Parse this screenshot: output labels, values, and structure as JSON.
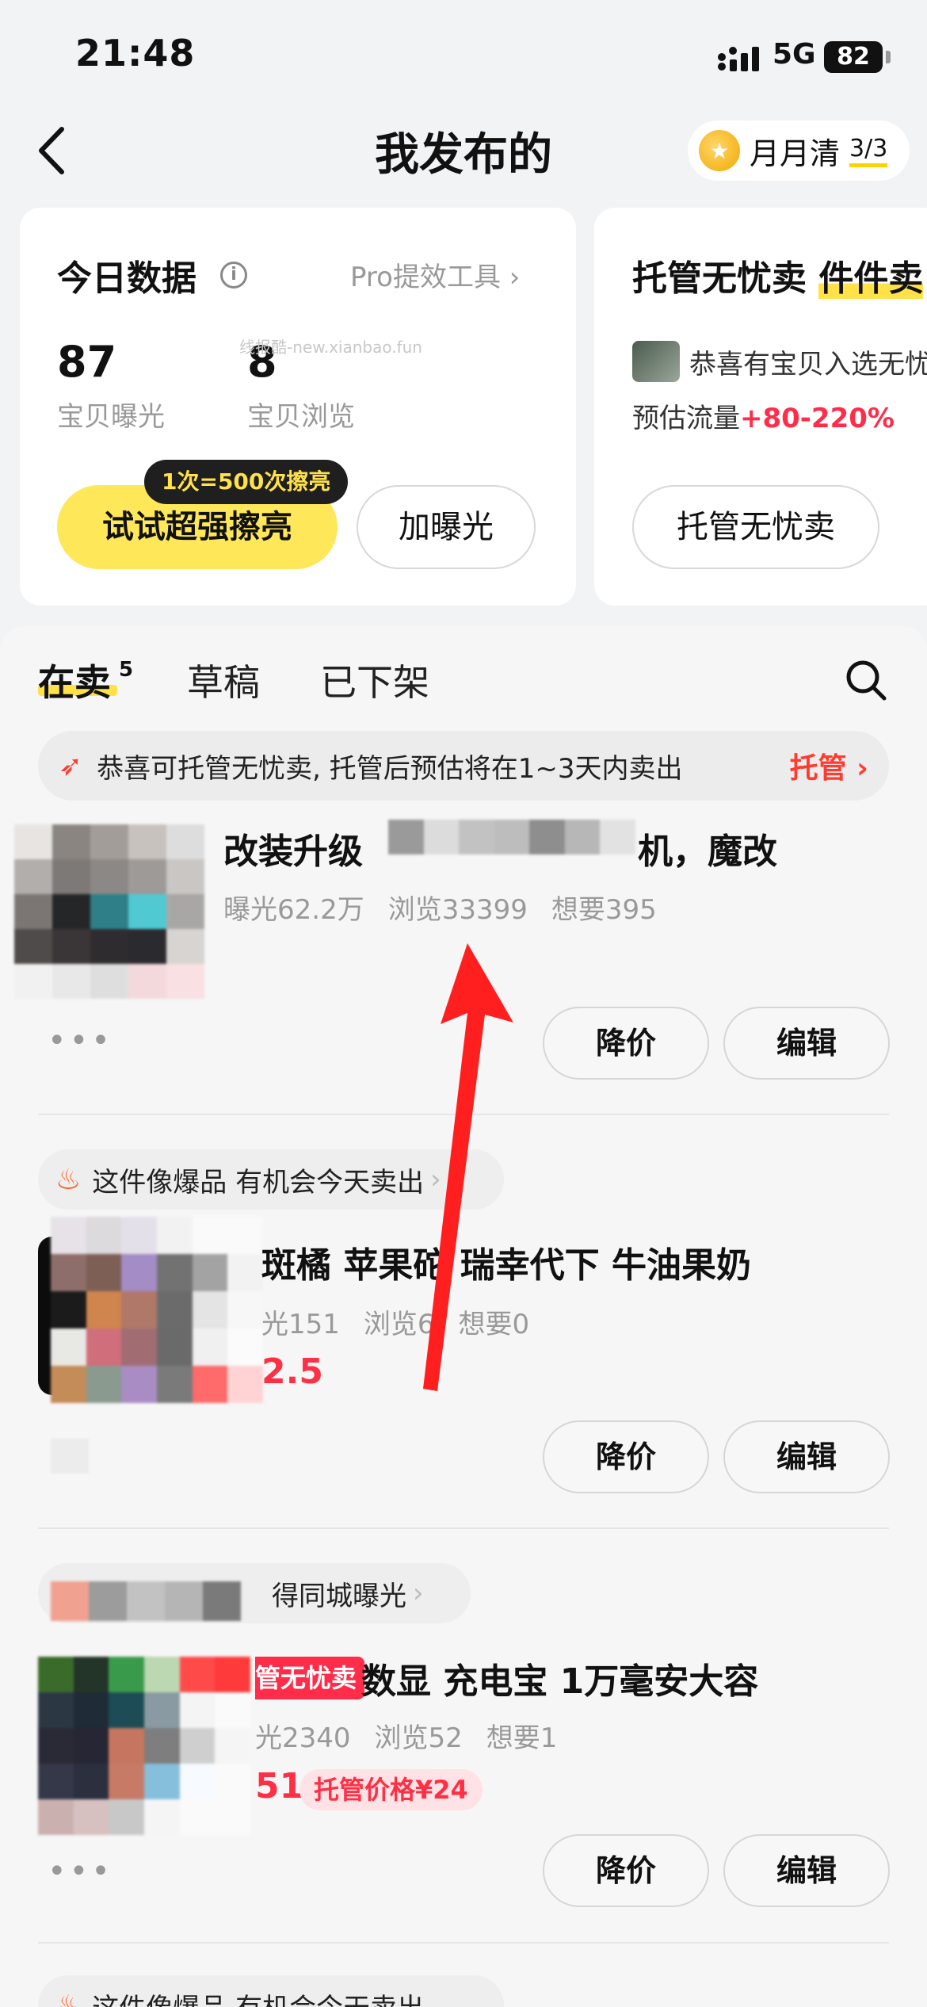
{
  "status": {
    "time": "21:48",
    "network": "5G",
    "battery": "82"
  },
  "nav": {
    "title": "我发布的",
    "badge_label": "月月清",
    "badge_count": "3/3"
  },
  "today": {
    "title": "今日数据",
    "pro_link": "Pro提效工具",
    "exposure_value": "87",
    "exposure_label": "宝贝曝光",
    "views_value": "8",
    "views_label": "宝贝浏览",
    "watermark": "线报酷-new.xianbao.fun",
    "tip": "1次=500次擦亮",
    "primary_button": "试试超强擦亮",
    "secondary_button": "加曝光"
  },
  "managed": {
    "title_a": "托管无忧卖",
    "title_b": "件件卖",
    "line1": "恭喜有宝贝入选无忧",
    "line2_prefix": "预估流量",
    "line2_value": "+80-220%",
    "button": "托管无忧卖"
  },
  "tabs": {
    "selling": "在卖",
    "selling_count": "5",
    "drafts": "草稿",
    "removed": "已下架"
  },
  "banner": {
    "text": "恭喜可托管无忧卖, 托管后预估将在1~3天内卖出",
    "link": "托管"
  },
  "items": [
    {
      "title_left": "改装升级",
      "title_right": "机，魔改",
      "exposure": "曝光62.2万",
      "views": "浏览33399",
      "wants": "想要395",
      "more": "•••",
      "btn_discount": "降价",
      "btn_edit": "编辑"
    },
    {
      "hint": "这件像爆品 有机会今天卖出",
      "title": "斑橘 苹果砣 瑞幸代下 牛油果奶",
      "exposure": "光151",
      "views": "浏览6",
      "wants": "想要0",
      "price": "2.5",
      "btn_discount": "降价",
      "btn_edit": "编辑"
    },
    {
      "hint": "得同城曝光",
      "tag": "管无忧卖",
      "title": "数显 充电宝 1万毫安大容",
      "exposure": "光2340",
      "views": "浏览52",
      "wants": "想要1",
      "price": "51",
      "managed_price": "托管价格¥24",
      "more": "•••",
      "btn_discount": "降价",
      "btn_edit": "编辑"
    }
  ],
  "bottom_hint": "这件像爆品 有机会今天卖出",
  "colors": {
    "accent_yellow": "#ffe75a",
    "red": "#ff3045",
    "arrow": "#ff1f1f"
  }
}
